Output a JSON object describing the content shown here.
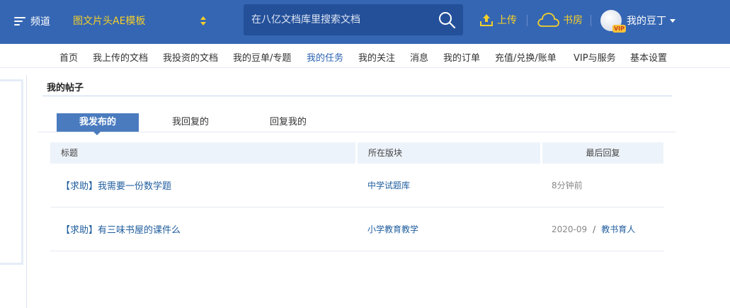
{
  "header": {
    "channel_label": "频道",
    "category_label": "图文片头AE模板",
    "search_placeholder": "在八亿文档库里搜索文档",
    "upload_label": "上传",
    "bookroom_label": "书房",
    "user_label": "我的豆丁",
    "vip_badge": "VIP"
  },
  "subnav": {
    "items": [
      "首页",
      "我上传的文档",
      "我投资的文档",
      "我的豆单/专题",
      "我的任务",
      "我的关注",
      "消息",
      "我的订单",
      "充值/兑换/账单",
      "VIP与服务",
      "基本设置"
    ],
    "active": "我的任务"
  },
  "section": {
    "title": "我的帖子"
  },
  "tabs": [
    "我发布的",
    "我回复的",
    "回复我的"
  ],
  "table": {
    "headers": [
      "标题",
      "所在版块",
      "最后回复"
    ],
    "rows": [
      {
        "title": "【求助】我需要一份数学题",
        "board": "中学试题库",
        "last_reply": "8分钟前",
        "separator": "",
        "reply_user": ""
      },
      {
        "title": "【求助】有三味书屋的课件么",
        "board": "小学教育教学",
        "last_reply": "2020-09",
        "separator": "/",
        "reply_user": "教书育人"
      }
    ]
  },
  "colors": {
    "header_bg": "#3566b3",
    "accent_yellow": "#f6d02a",
    "link_blue": "#1f5d9e",
    "tab_active": "#4a7bbf"
  },
  "icons": [
    "menu-icon",
    "sort-arrows-icon",
    "search-icon",
    "upload-icon",
    "cloud-icon",
    "avatar",
    "chevron-down-icon"
  ]
}
